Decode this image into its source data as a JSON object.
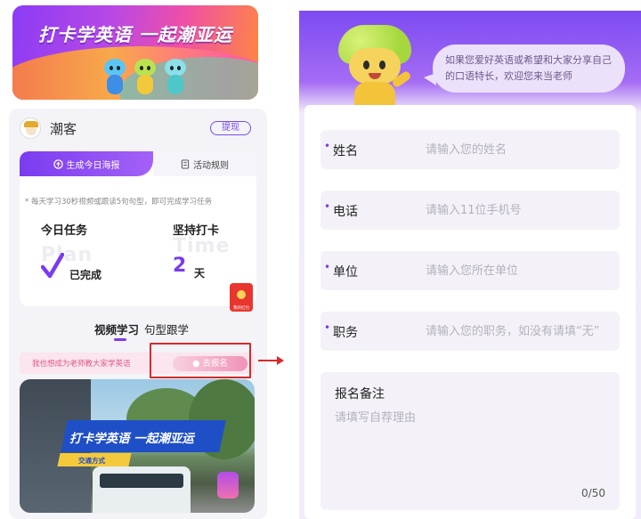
{
  "left_panel": {
    "banner": {
      "title": "打卡学英语 一起潮亚运"
    },
    "user": {
      "name": "潮客",
      "withdraw_label": "提现"
    },
    "task_tabs": {
      "share_poster": "生成今日海报",
      "rules": "活动规则"
    },
    "task_note": "* 每天学习30秒视频或跟读5句句型，即可完成学习任务",
    "today_task": {
      "title": "今日任务",
      "ghost": "Plan",
      "status": "已完成"
    },
    "streak": {
      "title": "坚持打卡",
      "ghost": "Time",
      "days": "2",
      "unit": "天"
    },
    "red_packet_label": "我的红包",
    "sub_tabs": [
      {
        "label": "视频学习",
        "active": true
      },
      {
        "label": "句型跟学",
        "active": false
      }
    ],
    "cta": {
      "text": "我也想成为老师教大家学英语",
      "button": "去报名"
    },
    "video": {
      "title": "打卡学英语 一起潮亚运",
      "tag": "交通方式"
    }
  },
  "right_panel": {
    "bubble_text": "如果您爱好英语或希望和大家分享自己的口语特长，欢迎您来当老师",
    "form": {
      "fields": [
        {
          "label": "姓名",
          "placeholder": "请输入您的姓名",
          "required": true
        },
        {
          "label": "电话",
          "placeholder": "请输入11位手机号",
          "required": true
        },
        {
          "label": "单位",
          "placeholder": "请输入您所在单位",
          "required": true
        },
        {
          "label": "职务",
          "placeholder": "请输入您的职务，如没有请填“无”",
          "required": true
        }
      ],
      "remark": {
        "label": "报名备注",
        "placeholder": "请填写自荐理由",
        "counter": "0/50"
      }
    }
  },
  "colors": {
    "accent_purple": "#7a3cf0",
    "highlight_red": "#d92a2a",
    "cta_pink": "#e0588a"
  }
}
